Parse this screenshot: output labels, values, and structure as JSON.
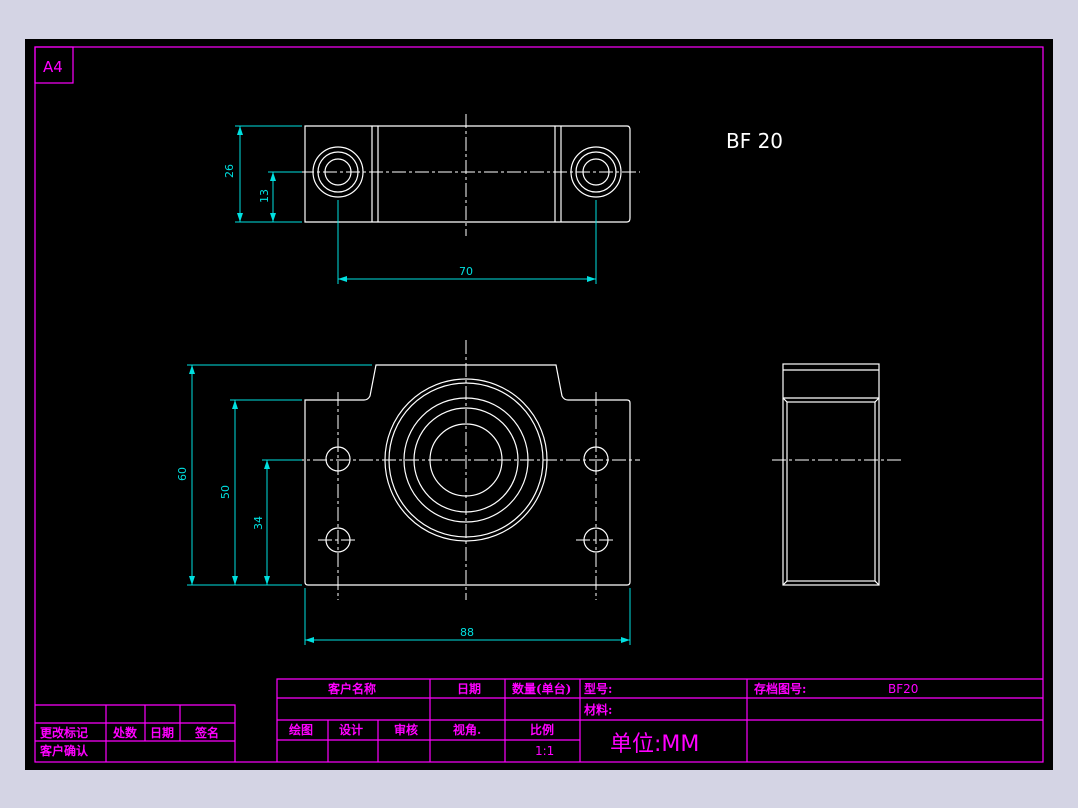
{
  "sheet": {
    "size_label": "A4",
    "part_label": "BF 20"
  },
  "dimensions": {
    "top_view_height": "26",
    "top_view_center": "13",
    "top_view_hole_spacing": "70",
    "front_view_total_height": "60",
    "front_view_body_height": "50",
    "front_view_center_height": "34",
    "front_view_width": "88"
  },
  "title_block": {
    "customer_name_label": "客户名称",
    "date_label": "日期",
    "quantity_label": "数量(单台)",
    "model_label": "型号:",
    "archive_no_label": "存档图号:",
    "archive_no_value": "BF20",
    "material_label": "材料:",
    "drawing_label": "绘图",
    "design_label": "设计",
    "review_label": "审核",
    "view_angle_label": "视角.",
    "scale_label": "比例",
    "scale_value": "1:1",
    "unit_label": "单位:MM"
  },
  "revision_block": {
    "change_mark_label": "更改标记",
    "place_count_label": "处数",
    "date_label": "日期",
    "signature_label": "签名",
    "customer_confirm_label": "客户确认"
  },
  "colors": {
    "background": "#000000",
    "frame": "#ff00ff",
    "geometry": "#ffffff",
    "dimension": "#00e0e0"
  }
}
